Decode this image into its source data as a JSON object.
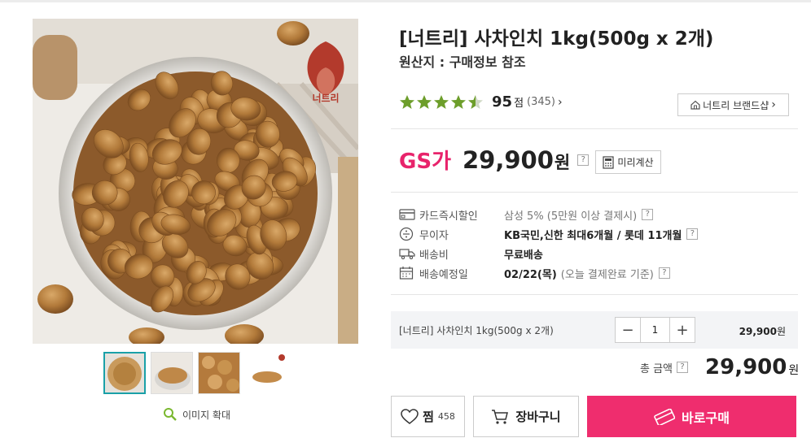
{
  "product": {
    "title": "[너트리] 사차인치 1kg(500g x 2개)",
    "origin": "원산지 : 구매정보 참조",
    "logo_text": "너트리",
    "rating_stars": 4.5,
    "score": "95",
    "score_unit": "점",
    "review_count": "(345)",
    "brand_shop_label": "너트리 브랜드샵"
  },
  "gallery": {
    "thumbnail_count": 4,
    "selected_index": 0,
    "zoom_label": "이미지 확대"
  },
  "price": {
    "gs_label": "GS가",
    "amount": "29,900",
    "currency": "원",
    "help": "?",
    "calc_label": "미리계산"
  },
  "info": [
    {
      "icon": "card-icon",
      "label": "카드즉시할인",
      "value": "삼성 5% (5만원 이상 결제시)",
      "bold": false,
      "help": "?"
    },
    {
      "icon": "interest-free-icon",
      "label": "무이자",
      "value": "KB국민,신한 최대6개월 / 롯데 11개월",
      "bold": true,
      "help": "?"
    },
    {
      "icon": "truck-icon",
      "label": "배송비",
      "value": "무료배송",
      "bold": true,
      "help": ""
    },
    {
      "icon": "calendar-icon",
      "label": "배송예정일",
      "value": "02/22(목)",
      "value2": "(오늘 결제완료 기준)",
      "bold": true,
      "help": "?"
    }
  ],
  "option": {
    "name": "[너트리] 사차인치 1kg(500g x 2개)",
    "minus": "−",
    "plus": "+",
    "quantity": "1",
    "price": "29,900",
    "currency": "원"
  },
  "total": {
    "label": "총 금액",
    "help": "?",
    "amount": "29,900",
    "currency": "원"
  },
  "actions": {
    "like_label": "찜",
    "like_count": "458",
    "cart_label": "장바구니",
    "buy_label": "바로구매"
  },
  "colors": {
    "accent": "#ef2d6e",
    "gs": "#e8236b",
    "star": "#6d9e2b",
    "thumb_border": "#1aa0a8"
  }
}
